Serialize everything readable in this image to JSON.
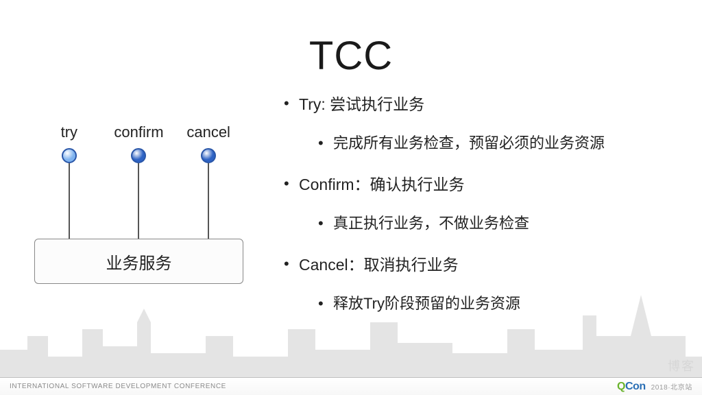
{
  "title": "TCC",
  "diagram": {
    "stems": [
      {
        "label": "try",
        "color": "#7fb3ef"
      },
      {
        "label": "confirm",
        "color": "#2e63c4"
      },
      {
        "label": "cancel",
        "color": "#2e63c4"
      }
    ],
    "box_label": "业务服务"
  },
  "bullets": [
    {
      "text": "Try: 尝试执行业务",
      "sub": [
        "完成所有业务检查，预留必须的业务资源"
      ]
    },
    {
      "text": "Confirm：确认执行业务",
      "sub": [
        "真正执行业务，不做业务检查"
      ]
    },
    {
      "text": "Cancel：取消执行业务",
      "sub": [
        "释放Try阶段预留的业务资源"
      ]
    }
  ],
  "footer": {
    "left": "INTERNATIONAL SOFTWARE DEVELOPMENT CONFERENCE",
    "brand_q": "Q",
    "brand_con": "Con",
    "right": "2018·北京站"
  },
  "watermark": "博客"
}
